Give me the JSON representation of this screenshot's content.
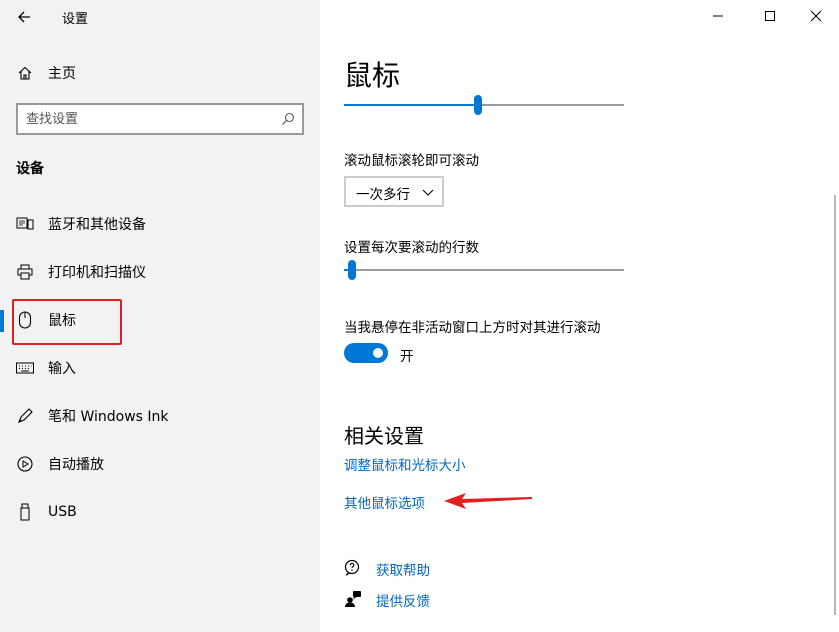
{
  "window": {
    "title": "设置",
    "controls": {
      "minimize": "minimize-icon",
      "maximize": "maximize-icon",
      "close": "close-icon"
    }
  },
  "sidebar": {
    "home_label": "主页",
    "search_placeholder": "查找设置",
    "section_header": "设备",
    "items": [
      {
        "label": "蓝牙和其他设备",
        "icon": "bluetooth-devices-icon"
      },
      {
        "label": "打印机和扫描仪",
        "icon": "printer-icon"
      },
      {
        "label": "鼠标",
        "icon": "mouse-icon",
        "selected": true
      },
      {
        "label": "输入",
        "icon": "keyboard-icon"
      },
      {
        "label": "笔和 Windows Ink",
        "icon": "pen-icon"
      },
      {
        "label": "自动播放",
        "icon": "autoplay-icon"
      },
      {
        "label": "USB",
        "icon": "usb-icon"
      }
    ]
  },
  "main": {
    "title": "鼠标",
    "top_slider": {
      "value_fraction": 0.48
    },
    "scroll_wheel_label": "滚动鼠标滚轮即可滚动",
    "scroll_dropdown_value": "一次多行",
    "lines_label": "设置每次要滚动的行数",
    "lines_slider": {
      "value_fraction": 0.03
    },
    "inactive_scroll_label": "当我悬停在非活动窗口上方时对其进行滚动",
    "toggle_state_label": "开",
    "toggle_on": true,
    "related_title": "相关设置",
    "related_links": [
      "调整鼠标和光标大小",
      "其他鼠标选项"
    ],
    "help_links": [
      {
        "label": "获取帮助",
        "icon": "help-chat-icon"
      },
      {
        "label": "提供反馈",
        "icon": "feedback-icon"
      }
    ]
  },
  "colors": {
    "accent": "#0078d7",
    "link": "#0067c0",
    "annotation": "#e02020"
  }
}
